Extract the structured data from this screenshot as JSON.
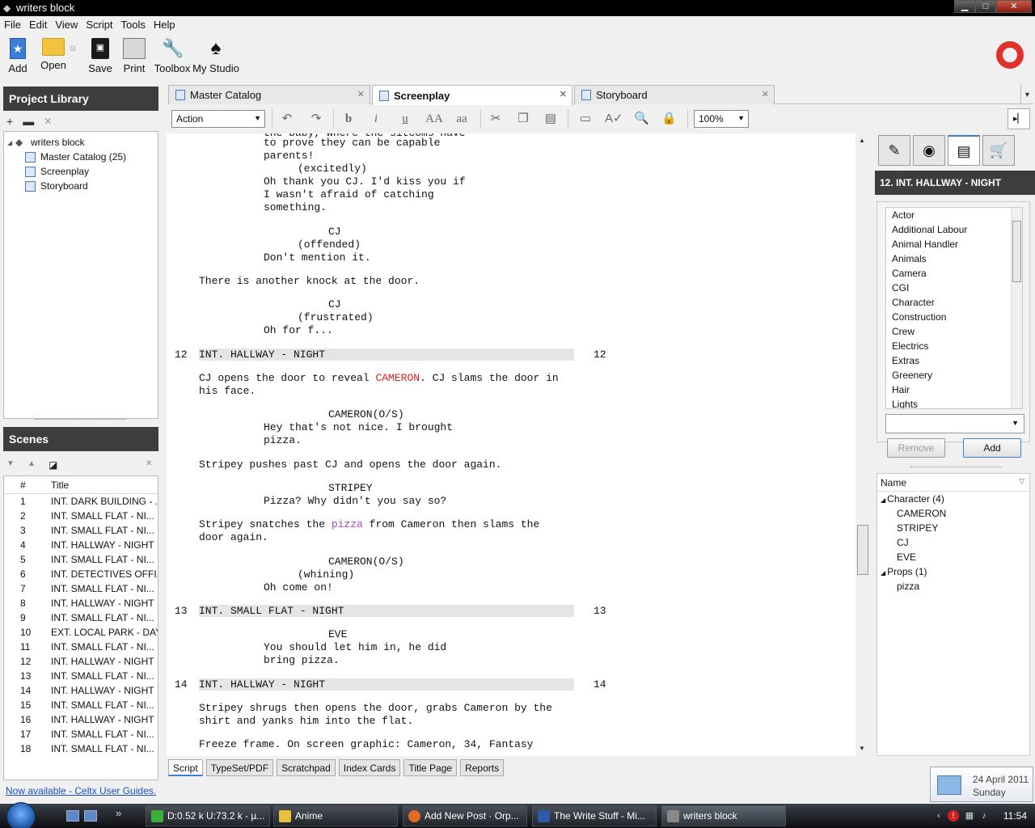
{
  "window": {
    "title": "writers block"
  },
  "menu": [
    "File",
    "Edit",
    "View",
    "Script",
    "Tools",
    "Help"
  ],
  "toolbar": {
    "add": "Add",
    "open": "Open",
    "save": "Save",
    "print": "Print",
    "toolbox": "Toolbox",
    "studio": "My Studio"
  },
  "project_library": {
    "title": "Project Library",
    "root": "writers block",
    "items": [
      "Master Catalog (25)",
      "Screenplay",
      "Storyboard"
    ]
  },
  "scenes": {
    "title": "Scenes",
    "col_num": "#",
    "col_title": "Title",
    "rows": [
      {
        "n": "1",
        "t": "INT. DARK BUILDING - ..."
      },
      {
        "n": "2",
        "t": "INT. SMALL FLAT - NI..."
      },
      {
        "n": "3",
        "t": "INT. SMALL FLAT - NI..."
      },
      {
        "n": "4",
        "t": "INT. HALLWAY - NIGHT"
      },
      {
        "n": "5",
        "t": "INT. SMALL FLAT - NI..."
      },
      {
        "n": "6",
        "t": "INT. DETECTIVES OFFI..."
      },
      {
        "n": "7",
        "t": "INT. SMALL FLAT - NI..."
      },
      {
        "n": "8",
        "t": "INT. HALLWAY - NIGHT"
      },
      {
        "n": "9",
        "t": "INT. SMALL FLAT - NI..."
      },
      {
        "n": "10",
        "t": "EXT. LOCAL PARK - DAY"
      },
      {
        "n": "11",
        "t": "INT. SMALL FLAT - NI..."
      },
      {
        "n": "12",
        "t": "INT. HALLWAY - NIGHT"
      },
      {
        "n": "13",
        "t": "INT. SMALL FLAT - NI..."
      },
      {
        "n": "14",
        "t": "INT. HALLWAY - NIGHT"
      },
      {
        "n": "15",
        "t": "INT. SMALL FLAT - NI..."
      },
      {
        "n": "16",
        "t": "INT. HALLWAY - NIGHT"
      },
      {
        "n": "17",
        "t": "INT. SMALL FLAT - NI..."
      },
      {
        "n": "18",
        "t": "INT. SMALL FLAT - NI..."
      }
    ]
  },
  "now_available": "Now available - Celtx User Guides.",
  "doc_tabs": [
    "Master Catalog",
    "Screenplay",
    "Storyboard"
  ],
  "edit_toolbar": {
    "element": "Action",
    "zoom": "100%",
    "bold": "b",
    "italic": "i",
    "underline": "u",
    "upper": "AA",
    "lower": "aa"
  },
  "script": {
    "top_partial": "the baby, where the sitcoms have",
    "lines": {
      "l1": "to prove they can be capable",
      "l2": "parents!",
      "l3": "(excitedly)",
      "l4": "Oh thank you CJ. I'd kiss you if",
      "l5": "I wasn't afraid of catching",
      "l6": "something.",
      "l7": "CJ",
      "l8": "(offended)",
      "l9": "Don't mention it.",
      "l10": "There is another knock at the door.",
      "l11": "CJ",
      "l12": "(frustrated)",
      "l13": "Oh for f...",
      "s12": "12",
      "h12": "INT. HALLWAY - NIGHT",
      "a12a": "CJ opens the door to reveal ",
      "a12b": "CAMERON",
      "a12c": ". CJ slams the door in",
      "a12d": "his face.",
      "c1": "CAMERON(O/S)",
      "d1": "Hey that's not nice. I brought",
      "d2": "pizza.",
      "a2": "Stripey pushes past CJ and opens the door again.",
      "c2": "STRIPEY",
      "d3": "Pizza? Why didn't you say so?",
      "a3a": "Stripey snatches the ",
      "a3b": "pizza",
      "a3c": " from Cameron then slams the",
      "a3d": "door again.",
      "c3": "CAMERON(O/S)",
      "p3": "(whining)",
      "d4": "Oh come on!",
      "s13": "13",
      "h13": "INT. SMALL FLAT - NIGHT",
      "c4": "EVE",
      "d5": "You should let him in, he did",
      "d6": "bring pizza.",
      "s14": "14",
      "h14": "INT. HALLWAY - NIGHT",
      "a4a": "Stripey shrugs then opens the door, grabs Cameron by the",
      "a4b": "shirt and yanks him into the flat.",
      "a5": "Freeze frame. On screen graphic: Cameron, 34, Fantasy"
    }
  },
  "bottom_tabs": [
    "Script",
    "TypeSet/PDF",
    "Scratchpad",
    "Index Cards",
    "Title Page",
    "Reports"
  ],
  "right_panel": {
    "scene_title": "12. INT. HALLWAY - NIGHT",
    "categories": [
      "Actor",
      "Additional Labour",
      "Animal Handler",
      "Animals",
      "Camera",
      "CGI",
      "Character",
      "Construction",
      "Crew",
      "Electrics",
      "Extras",
      "Greenery",
      "Hair",
      "Lights"
    ],
    "remove": "Remove",
    "add": "Add",
    "name_header": "Name",
    "groups": [
      {
        "label": "Character (4)",
        "items": [
          "CAMERON",
          "STRIPEY",
          "CJ",
          "EVE"
        ]
      },
      {
        "label": "Props (1)",
        "items": [
          "pizza"
        ]
      }
    ]
  },
  "clock_popup": {
    "date": "24 April 2011",
    "day": "Sunday"
  },
  "taskbar": {
    "tasks": [
      "D:0.52 k U:73.2 k - µ...",
      "Anime",
      "Add New Post · Orp...",
      "The Write Stuff - Mi...",
      "writers block"
    ],
    "time": "11:54"
  },
  "colors": {
    "accent": "#3c7fd4",
    "header_bg": "#3d3d3d",
    "highlight_red": "#e02020",
    "highlight_purple": "#b040c8"
  }
}
